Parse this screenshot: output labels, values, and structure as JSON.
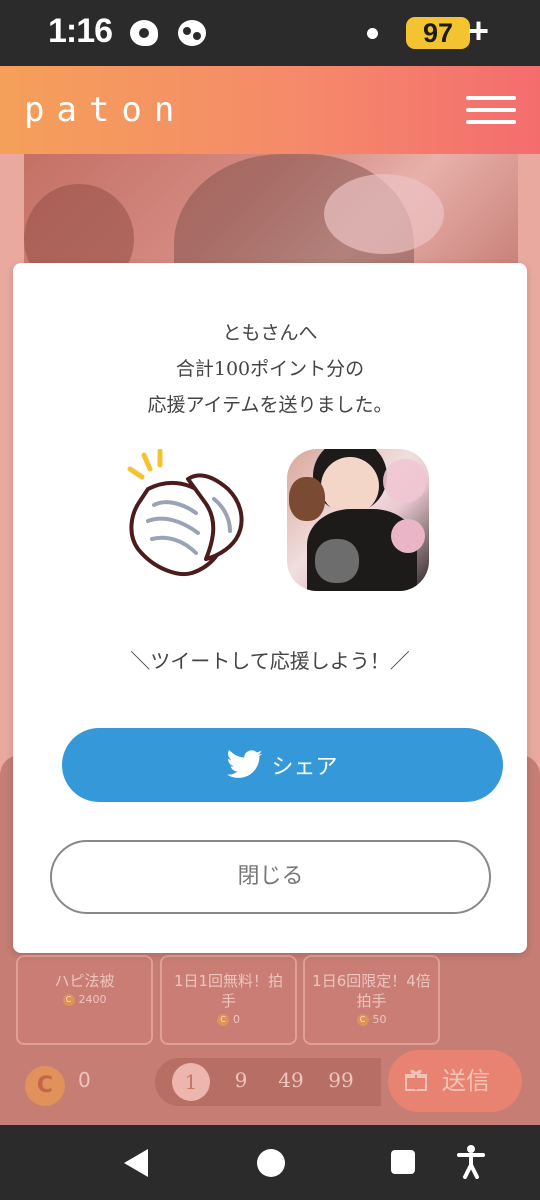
{
  "status_bar": {
    "time": "1:16",
    "battery": "97",
    "battery_suffix": "+"
  },
  "header": {
    "logo": "paton"
  },
  "modal": {
    "message_lines": [
      "ともさんへ",
      "合計100ポイント分の",
      "応援アイテムを送りました。"
    ],
    "tweet_prompt": "＼ツイートして応援しよう！／",
    "share_label": "シェア",
    "close_label": "閉じる"
  },
  "items": [
    {
      "name": "ハピ法被",
      "price": "2400"
    },
    {
      "name": "1日1回無料！拍手",
      "price": "0"
    },
    {
      "name": "1日6回限定！4倍拍手",
      "price": "50"
    }
  ],
  "footer": {
    "coin_symbol": "C",
    "coin_balance": "0",
    "quantities": [
      "1",
      "9",
      "49",
      "99"
    ],
    "selected_quantity": "1",
    "send_label": "送信"
  },
  "colors": {
    "header_start": "#f5a05a",
    "header_end": "#f46d6e",
    "share_button": "#3598d8",
    "send_button": "#f28772",
    "battery": "#f4c430"
  },
  "icons": {
    "share_button_icon": "twitter-bird-icon",
    "send_button_icon": "gift-icon",
    "item_image": "clapping-hands-icon"
  }
}
